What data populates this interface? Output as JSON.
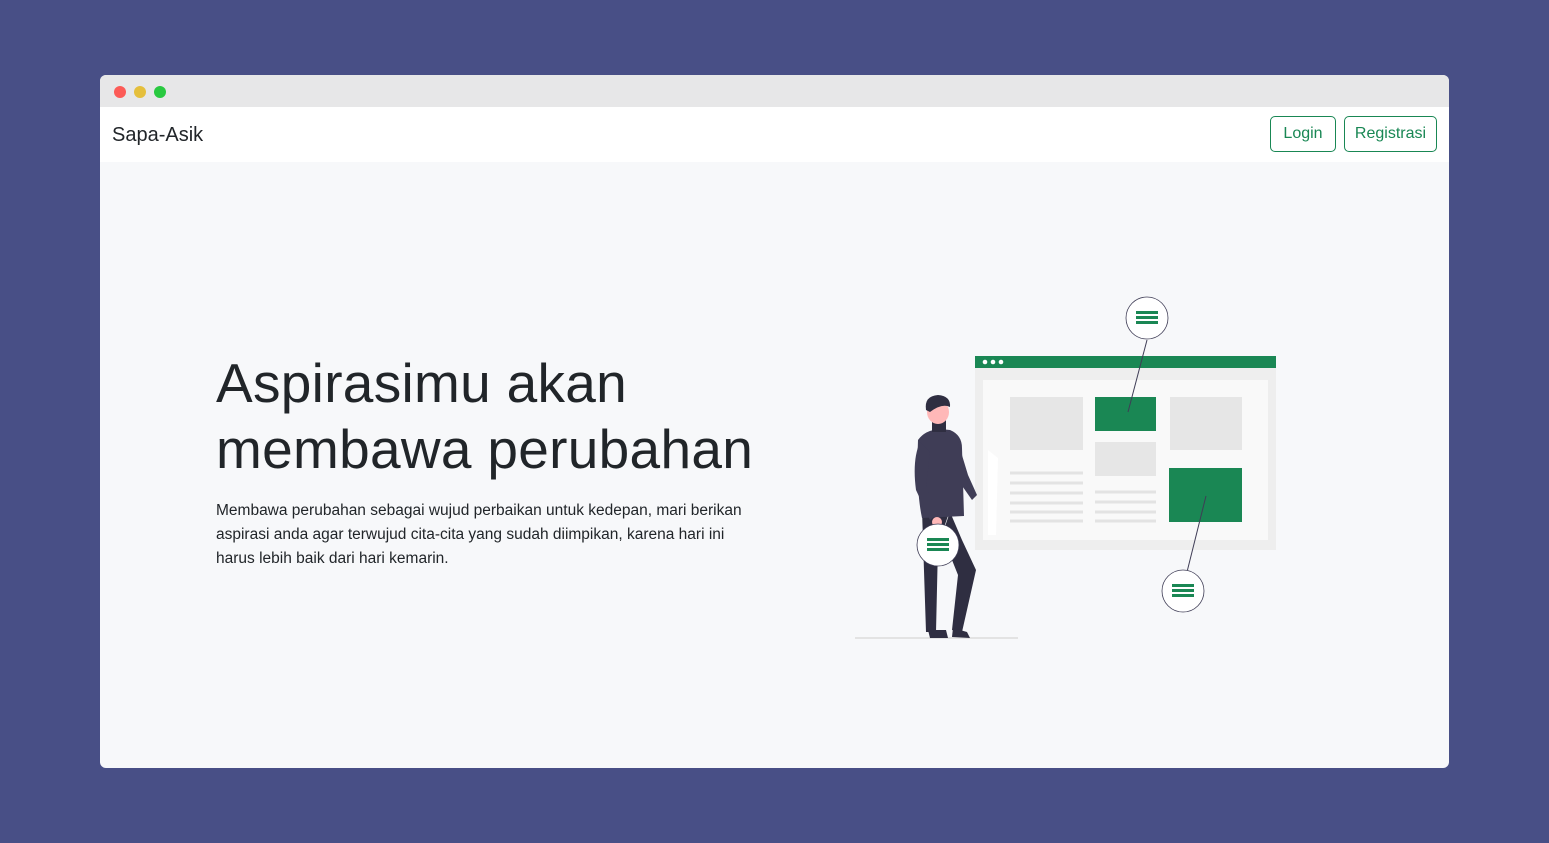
{
  "window": {
    "controls": [
      "close",
      "minimize",
      "maximize"
    ],
    "colors": {
      "close": "#fc5b57",
      "minimize": "#e5bf3c",
      "maximize": "#29c940"
    }
  },
  "navbar": {
    "brand": "Sapa-Asik",
    "login_label": "Login",
    "register_label": "Registrasi",
    "accent_color": "#198754"
  },
  "hero": {
    "title": "Aspirasimu akan membawa perubahan",
    "description": "Membawa perubahan sebagai wujud perbaikan untuk kedepan, mari berikan aspirasi anda agar terwujud cita-cita yang sudah diimpikan, karena hari ini harus lebih baik dari hari kemarin."
  },
  "illustration": {
    "icon": "person-with-webpage-illustration",
    "accent_color": "#1a8754"
  }
}
